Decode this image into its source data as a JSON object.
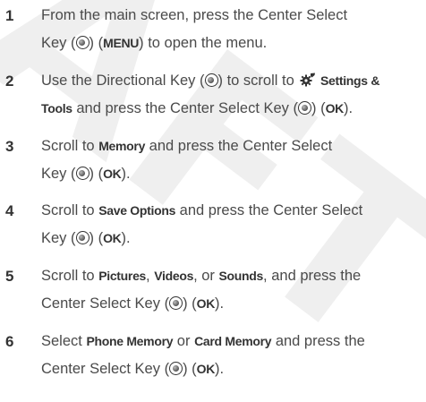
{
  "watermark": "AFT",
  "steps": [
    {
      "number": "1",
      "line1": {
        "t1": "From the main screen, press the Center Select"
      },
      "line2": {
        "t1": "Key (",
        "t2": ") (",
        "b1": "MENU",
        "t3": ") to open the menu."
      }
    },
    {
      "number": "2",
      "line1": {
        "t1": "Use the Directional Key (",
        "t2": ") to scroll to ",
        "b1": "Settings &"
      },
      "line2": {
        "b1": "Tools",
        "t1": " and press the Center Select Key (",
        "t2": ") (",
        "b2": "OK",
        "t3": ")."
      }
    },
    {
      "number": "3",
      "line1": {
        "t1": "Scroll to ",
        "b1": "Memory",
        "t2": " and press the Center Select"
      },
      "line2": {
        "t1": "Key (",
        "t2": ") (",
        "b1": "OK",
        "t3": ")."
      }
    },
    {
      "number": "4",
      "line1": {
        "t1": "Scroll to ",
        "b1": "Save Options",
        "t2": " and press the Center Select"
      },
      "line2": {
        "t1": "Key (",
        "t2": ") (",
        "b1": "OK",
        "t3": ")."
      }
    },
    {
      "number": "5",
      "line1": {
        "t1": "Scroll to ",
        "b1": "Pictures",
        "t2": ", ",
        "b2": "Videos",
        "t3": ", or ",
        "b3": "Sounds",
        "t4": ", and press the"
      },
      "line2": {
        "t1": "Center Select Key (",
        "t2": ") (",
        "b1": "OK",
        "t3": ")."
      }
    },
    {
      "number": "6",
      "line1": {
        "t1": "Select ",
        "b1": "Phone Memory",
        "t2": " or ",
        "b2": "Card Memory",
        "t3": " and press the"
      },
      "line2": {
        "t1": "Center Select Key (",
        "t2": ") (",
        "b1": "OK",
        "t3": ")."
      }
    }
  ],
  "icons": {
    "center_select_key": "center-select-key-icon",
    "directional_key": "directional-key-icon",
    "settings_tools": "gear-icon"
  }
}
